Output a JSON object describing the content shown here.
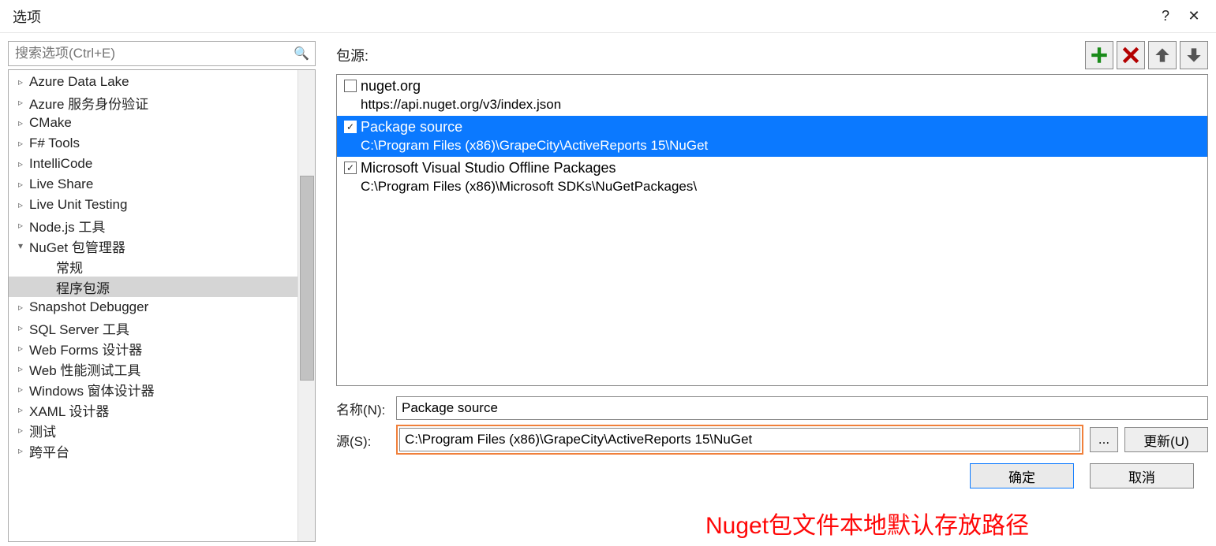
{
  "window": {
    "title": "选项",
    "help_icon": "?",
    "close_icon": "✕"
  },
  "search": {
    "placeholder": "搜索选项(Ctrl+E)"
  },
  "tree": [
    {
      "label": "Azure Data Lake",
      "state": "collapsed"
    },
    {
      "label": "Azure 服务身份验证",
      "state": "collapsed"
    },
    {
      "label": "CMake",
      "state": "collapsed"
    },
    {
      "label": "F# Tools",
      "state": "collapsed"
    },
    {
      "label": "IntelliCode",
      "state": "collapsed"
    },
    {
      "label": "Live Share",
      "state": "collapsed"
    },
    {
      "label": "Live Unit Testing",
      "state": "collapsed"
    },
    {
      "label": "Node.js 工具",
      "state": "collapsed"
    },
    {
      "label": "NuGet 包管理器",
      "state": "expanded"
    },
    {
      "label": "常规",
      "state": "child"
    },
    {
      "label": "程序包源",
      "state": "child",
      "selected": true
    },
    {
      "label": "Snapshot Debugger",
      "state": "collapsed"
    },
    {
      "label": "SQL Server 工具",
      "state": "collapsed"
    },
    {
      "label": "Web Forms 设计器",
      "state": "collapsed"
    },
    {
      "label": "Web 性能测试工具",
      "state": "collapsed"
    },
    {
      "label": "Windows 窗体设计器",
      "state": "collapsed"
    },
    {
      "label": "XAML 设计器",
      "state": "collapsed"
    },
    {
      "label": "测试",
      "state": "collapsed"
    },
    {
      "label": "跨平台",
      "state": "collapsed"
    }
  ],
  "right": {
    "sources_label": "包源:",
    "sources": [
      {
        "checked": false,
        "name": "nuget.org",
        "path": "https://api.nuget.org/v3/index.json",
        "selected": false
      },
      {
        "checked": true,
        "name": "Package source",
        "path": "C:\\Program Files (x86)\\GrapeCity\\ActiveReports 15\\NuGet",
        "selected": true
      },
      {
        "checked": true,
        "name": "Microsoft Visual Studio Offline Packages",
        "path": "C:\\Program Files (x86)\\Microsoft SDKs\\NuGetPackages\\",
        "selected": false
      }
    ],
    "name_label": "名称(N):",
    "name_value": "Package source",
    "source_label": "源(S):",
    "source_value": "C:\\Program Files (x86)\\GrapeCity\\ActiveReports 15\\NuGet",
    "browse_label": "...",
    "update_label": "更新(U)"
  },
  "annotation": "Nuget包文件本地默认存放路径",
  "footer": {
    "ok": "确定",
    "cancel": "取消"
  }
}
